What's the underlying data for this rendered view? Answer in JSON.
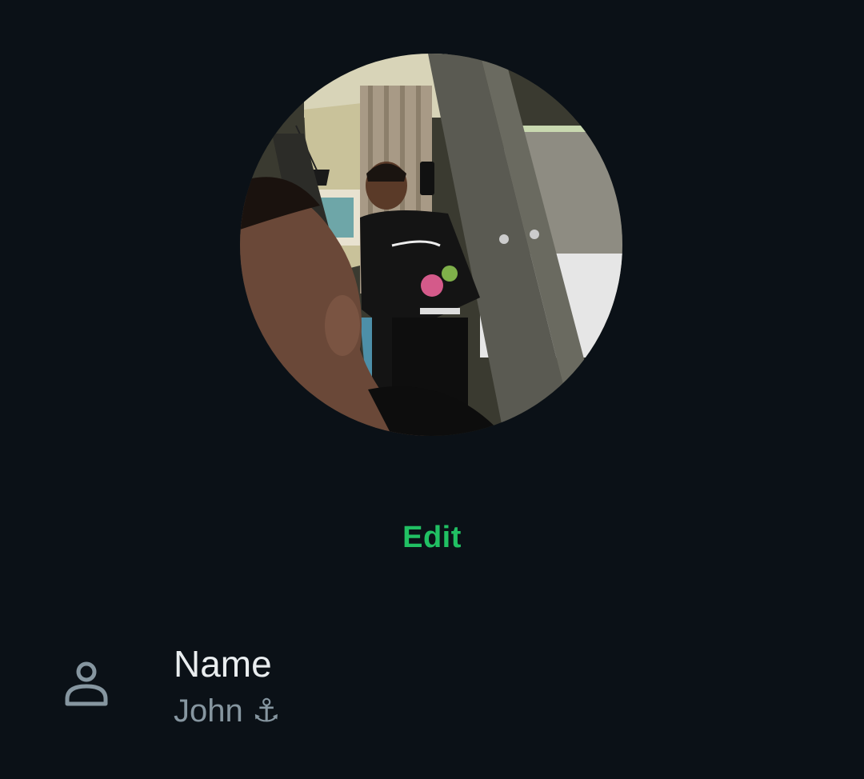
{
  "profile": {
    "photo_alt": "profile photo",
    "edit_label": "Edit"
  },
  "name_row": {
    "icon": "person-icon",
    "label": "Name",
    "value": "John ⚓"
  },
  "colors": {
    "background": "#0b1117",
    "accent": "#21c063",
    "primary_text": "#e9edef",
    "secondary_text": "#8696a0"
  }
}
